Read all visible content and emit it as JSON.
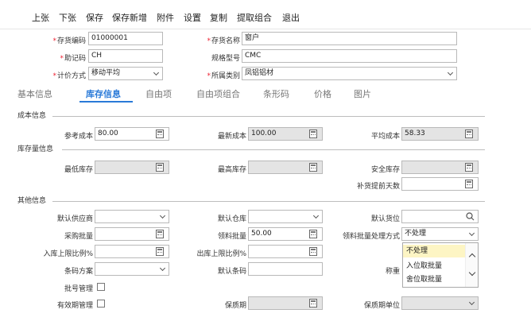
{
  "toolbar": {
    "items": [
      "上张",
      "下张",
      "保存",
      "保存新增",
      "附件",
      "设置",
      "复制",
      "提取组合",
      "退出"
    ]
  },
  "header": {
    "code": {
      "label": "存货编码",
      "value": "01000001"
    },
    "name": {
      "label": "存货名称",
      "value": "窗户"
    },
    "mnemonic": {
      "label": "助记码",
      "value": "CH"
    },
    "spec": {
      "label": "规格型号",
      "value": "CMC"
    },
    "valuation": {
      "label": "计价方式",
      "value": "移动平均"
    },
    "category": {
      "label": "所属类别",
      "value": "凤铝铝材"
    }
  },
  "tabs": [
    "基本信息",
    "库存信息",
    "自由项",
    "自由项组合",
    "条形码",
    "价格",
    "图片"
  ],
  "active_tab": "库存信息",
  "sections": {
    "cost": "成本信息",
    "stock": "库存量信息",
    "other": "其他信息"
  },
  "cost": {
    "ref": {
      "label": "参考成本",
      "value": "80.00"
    },
    "latest": {
      "label": "最新成本",
      "value": "100.00"
    },
    "avg": {
      "label": "平均成本",
      "value": "58.33"
    }
  },
  "stock": {
    "min": {
      "label": "最低库存"
    },
    "max": {
      "label": "最高库存"
    },
    "safe": {
      "label": "安全库存"
    },
    "lead": {
      "label": "补货提前天数"
    }
  },
  "other": {
    "supplier": {
      "label": "默认供应商"
    },
    "warehouse": {
      "label": "默认仓库"
    },
    "location": {
      "label": "默认货位"
    },
    "purchase_batch": {
      "label": "采购批量"
    },
    "pick_batch": {
      "label": "领料批量",
      "value": "50.00"
    },
    "pick_method": {
      "label": "领料批量处理方式",
      "value": "不处理"
    },
    "in_limit": {
      "label": "入库上限比例%"
    },
    "out_limit": {
      "label": "出库上限比例%"
    },
    "barcode_scheme": {
      "label": "条码方案"
    },
    "default_barcode": {
      "label": "默认条码"
    },
    "scale": {
      "label": "称重"
    },
    "batch_mgmt": {
      "label": "批号管理"
    },
    "expiry_mgmt": {
      "label": "有效期管理"
    },
    "shelf_life": {
      "label": "保质期"
    },
    "shelf_unit": {
      "label": "保质期单位"
    }
  },
  "dropdown": {
    "options": [
      "不处理",
      "入位取批量",
      "舍位取批量"
    ]
  }
}
